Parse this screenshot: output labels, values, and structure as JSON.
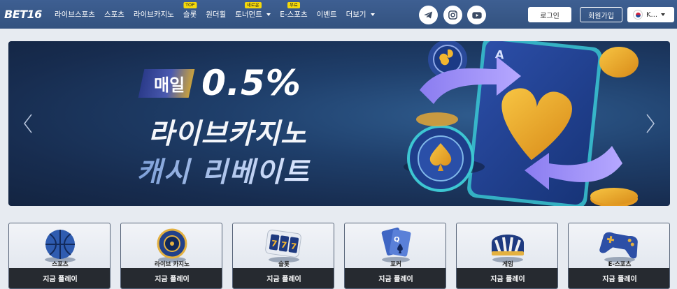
{
  "header": {
    "logo": "BET16",
    "nav": [
      {
        "label": "라이브스포츠",
        "badge": null,
        "dropdown": false
      },
      {
        "label": "스포츠",
        "badge": null,
        "dropdown": false
      },
      {
        "label": "라이브카지노",
        "badge": null,
        "dropdown": false
      },
      {
        "label": "슬롯",
        "badge": "TOP",
        "dropdown": false
      },
      {
        "label": "원더휠",
        "badge": null,
        "dropdown": false
      },
      {
        "label": "토너먼트",
        "badge": "새로운",
        "dropdown": true
      },
      {
        "label": "E-스포츠",
        "badge": "무료",
        "dropdown": false
      },
      {
        "label": "이벤트",
        "badge": null,
        "dropdown": false
      },
      {
        "label": "더보기",
        "badge": null,
        "dropdown": true
      }
    ],
    "social_icons": [
      "telegram-icon",
      "instagram-icon",
      "youtube-icon"
    ],
    "login_label": "로그인",
    "signup_label": "회원가입",
    "language": "K..."
  },
  "banner": {
    "daily_label": "매일",
    "percent": "0.5%",
    "line2": "라이브카지노",
    "line3": "캐시 리베이트"
  },
  "games": [
    {
      "label": "스포츠",
      "button": "지금 플레이",
      "icon": "basketball-icon"
    },
    {
      "label": "라이브 카지노",
      "button": "지금 플레이",
      "icon": "roulette-icon"
    },
    {
      "label": "슬롯",
      "button": "지금 플레이",
      "icon": "slot-machine-icon"
    },
    {
      "label": "포커",
      "button": "지금 플레이",
      "icon": "playing-cards-icon"
    },
    {
      "label": "게임",
      "button": "지금 플레이",
      "icon": "game-wheel-icon"
    },
    {
      "label": "E-스포츠",
      "button": "지금 플레이",
      "icon": "gamepad-icon"
    }
  ],
  "colors": {
    "header": "#3a5a8c",
    "banner": "#1b3560",
    "card_button": "#262a30",
    "badge": "#f5d90a",
    "gold": "#e8a824"
  }
}
